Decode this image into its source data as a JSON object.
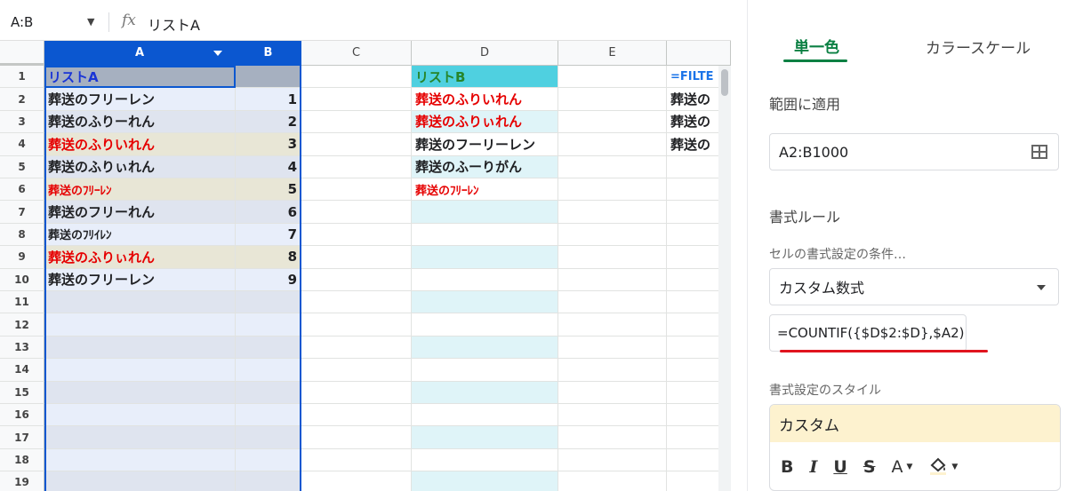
{
  "formula_bar": {
    "name_box": "A:B",
    "fx_symbol": "fx",
    "content": "リストA"
  },
  "columns": [
    "A",
    "B",
    "C",
    "D",
    "E"
  ],
  "row_numbers": [
    "1",
    "2",
    "3",
    "4",
    "5",
    "6",
    "7",
    "8",
    "9",
    "10",
    "11",
    "12",
    "13",
    "14",
    "15",
    "16",
    "17",
    "18",
    "19"
  ],
  "cells": {
    "A1": "リストA",
    "D1": "リストB",
    "F1": "=FILTE",
    "A2": "葬送のフリーレン",
    "B2": "1",
    "D2": "葬送のふりいれん",
    "F2": "葬送の",
    "A3": "葬送のふりーれん",
    "B3": "2",
    "D3": "葬送のふりぃれん",
    "F3": "葬送の",
    "A4": "葬送のふりいれん",
    "B4": "3",
    "D4": "葬送のフーリーレン",
    "F4": "葬送の",
    "A5": "葬送のふりぃれん",
    "B5": "4",
    "D5": "葬送のふーりがん",
    "A6": "葬送のﾌﾘｰﾚﾝ",
    "B6": "5",
    "D6": "葬送のﾌﾘｰﾚﾝ",
    "A7": "葬送のフリーれん",
    "B7": "6",
    "A8": "葬送のﾌﾘｲﾚﾝ",
    "B8": "7",
    "A9": "葬送のふりぃれん",
    "B9": "8",
    "A10": "葬送のフリーレン",
    "B10": "9"
  },
  "panel": {
    "tab_single": "単一色",
    "tab_scale": "カラースケール",
    "range_label": "範囲に適用",
    "range_value": "A2:B1000",
    "rules_label": "書式ルール",
    "condition_label": "セルの書式設定の条件…",
    "condition_value": "カスタム数式",
    "formula_value": "=COUNTIF({$D$2:$D},$A2)",
    "style_label": "書式設定のスタイル",
    "style_value": "カスタム",
    "toolbar": {
      "bold": "B",
      "italic": "I",
      "underline": "U",
      "strike": "S",
      "text_color": "A",
      "fill_icon": "paint-bucket-icon"
    }
  },
  "colors": {
    "selection": "#0b57d0",
    "highlight": "#e8e6d6",
    "red_text": "#e60000",
    "teal_header": "#4fd0e0",
    "tab_green": "#0b8043"
  }
}
